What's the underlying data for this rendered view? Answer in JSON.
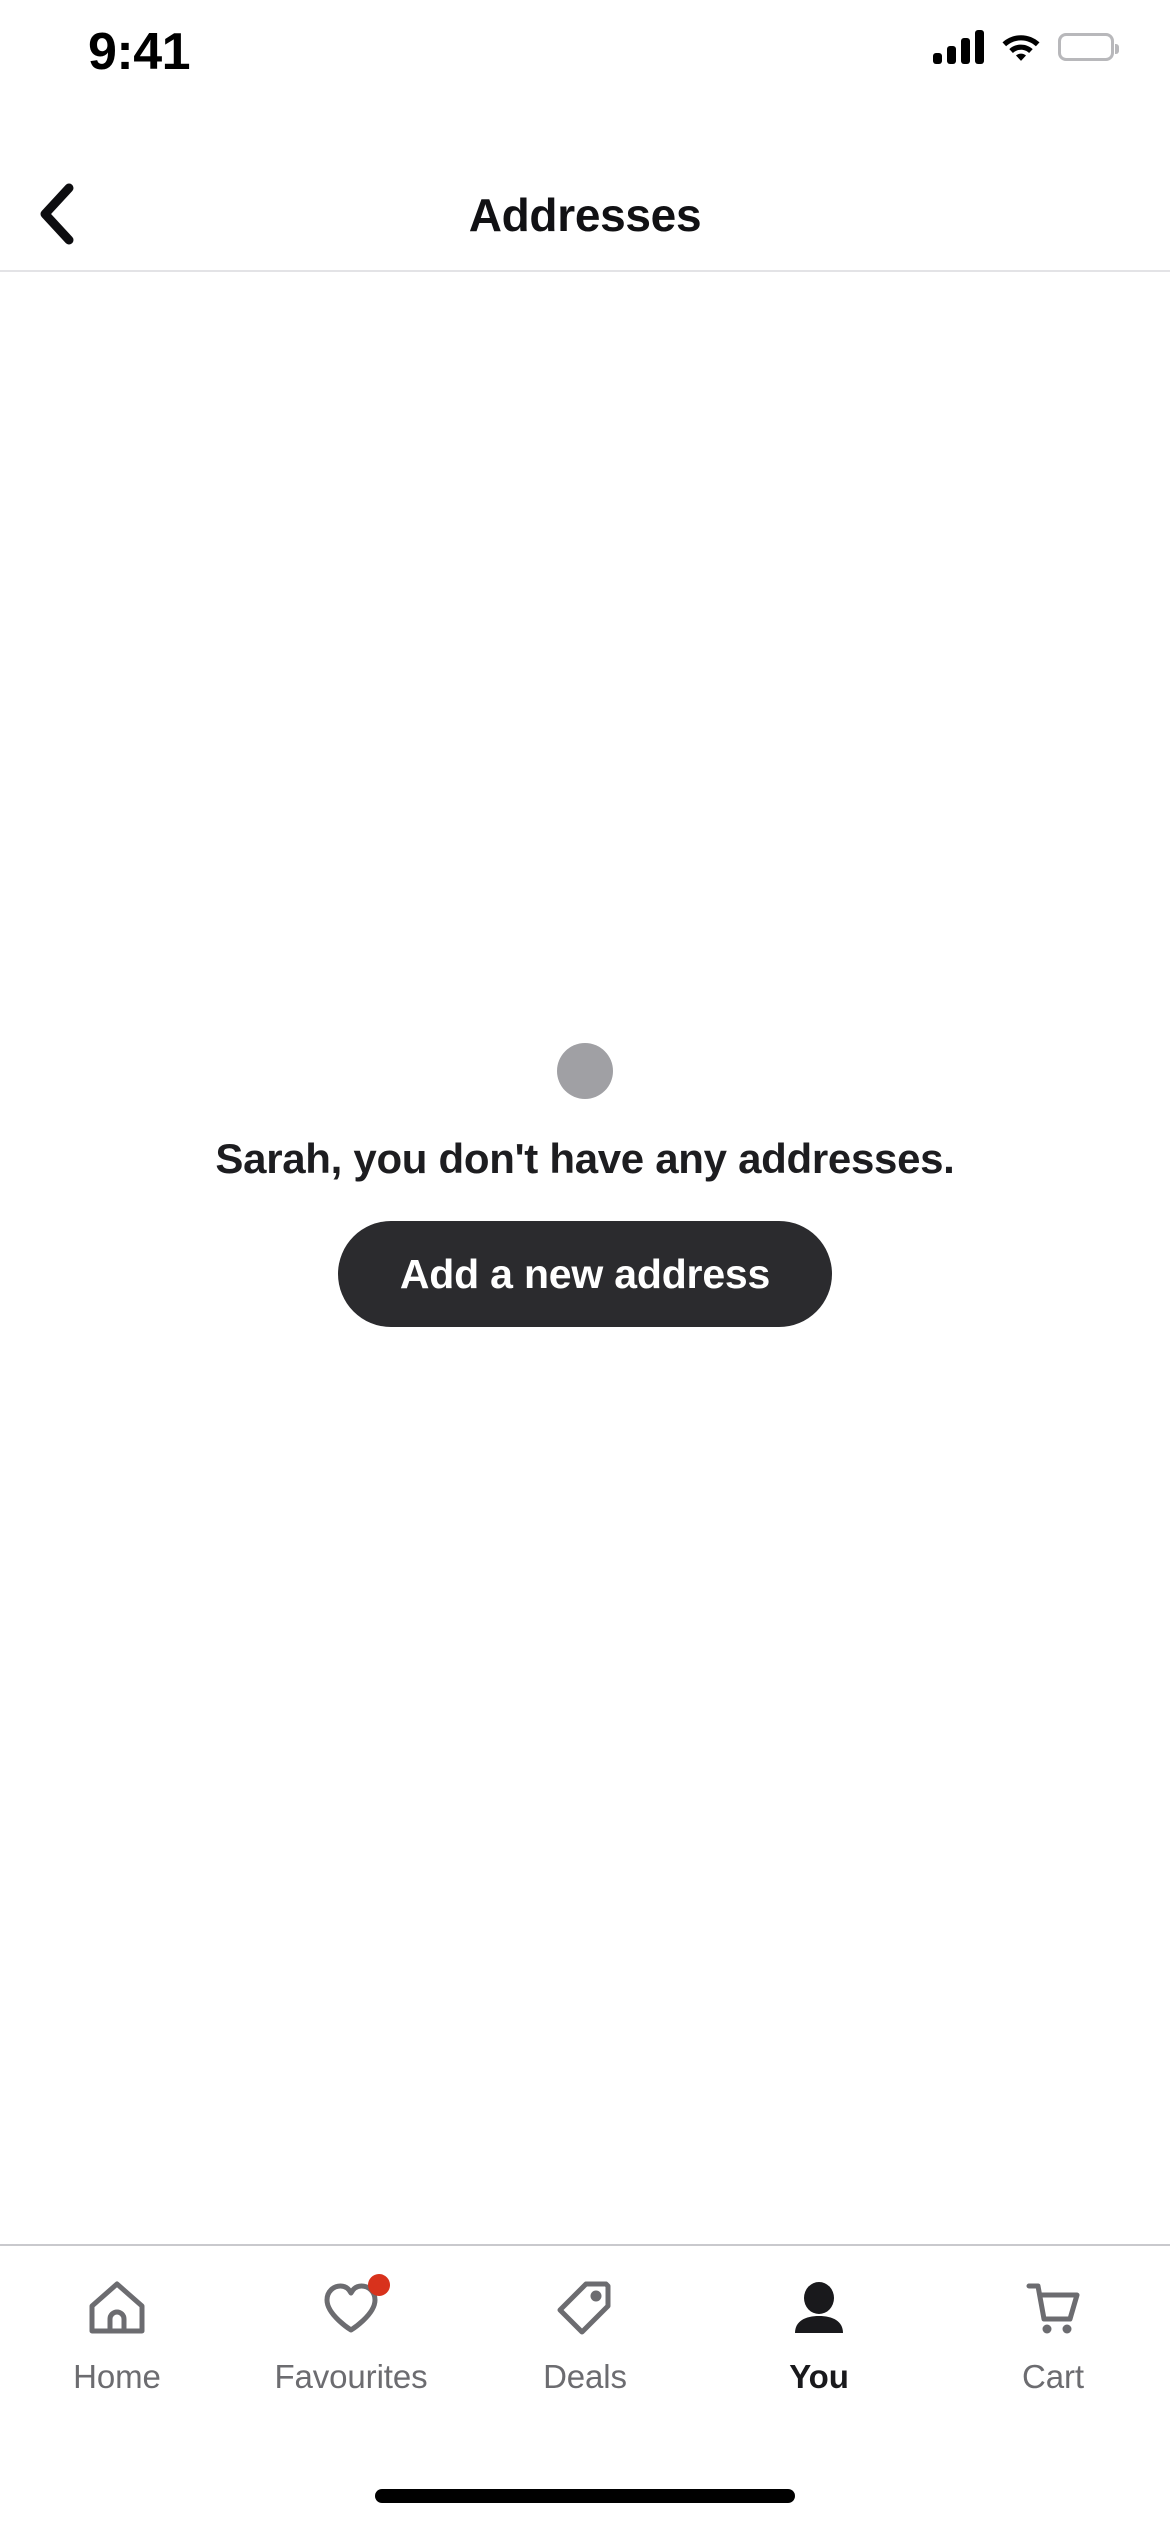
{
  "status_bar": {
    "time": "9:41",
    "signal_icon": "cellular-signal-icon",
    "wifi_icon": "wifi-icon",
    "battery_icon": "battery-full-icon"
  },
  "nav": {
    "back_icon": "chevron-left-icon",
    "title": "Addresses"
  },
  "empty_state": {
    "illustration_icon": "placeholder-circle-icon",
    "message": "Sarah, you don't have any addresses.",
    "cta_label": "Add a new address"
  },
  "tab_bar": {
    "active_index": 3,
    "items": [
      {
        "label": "Home",
        "icon": "house-icon",
        "badge": false
      },
      {
        "label": "Favourites",
        "icon": "heart-icon",
        "badge": true
      },
      {
        "label": "Deals",
        "icon": "tag-icon",
        "badge": false
      },
      {
        "label": "You",
        "icon": "person-icon",
        "badge": false
      },
      {
        "label": "Cart",
        "icon": "shopping-cart-icon",
        "badge": false
      }
    ]
  },
  "colors": {
    "accent_dark": "#2b2b2e",
    "badge_red": "#d8321c",
    "inactive_gray": "#6c6c70",
    "active_dark": "#19191c",
    "placeholder_gray": "#a0a0a4",
    "background": "#ffffff"
  }
}
